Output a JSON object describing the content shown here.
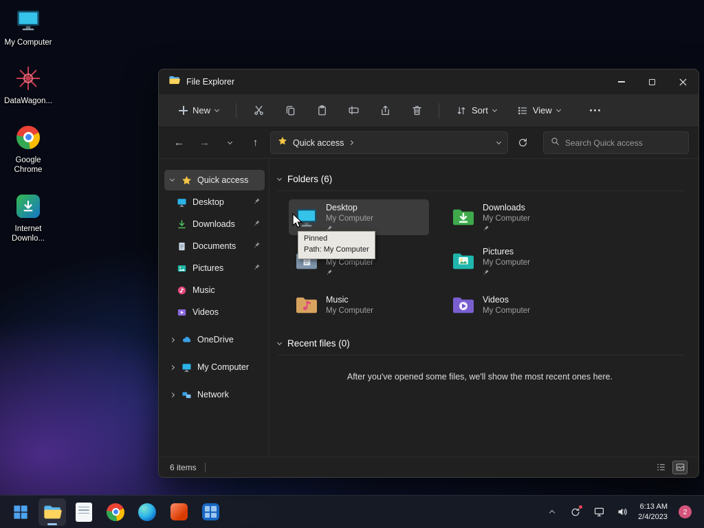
{
  "desktop": {
    "icons": [
      {
        "label": "My Computer"
      },
      {
        "label": "DataWagon..."
      },
      {
        "label": "Google Chrome"
      },
      {
        "label": "Internet Downlo..."
      }
    ]
  },
  "explorer": {
    "title": "File Explorer",
    "toolbar": {
      "new": "New",
      "sort": "Sort",
      "view": "View"
    },
    "address": {
      "crumb": "Quick access"
    },
    "search": {
      "placeholder": "Search Quick access"
    },
    "sidebar": {
      "quick_access": "Quick access",
      "pinned_items": [
        {
          "label": "Desktop",
          "pinned": true
        },
        {
          "label": "Downloads",
          "pinned": true
        },
        {
          "label": "Documents",
          "pinned": true
        },
        {
          "label": "Pictures",
          "pinned": true
        },
        {
          "label": "Music",
          "pinned": false
        },
        {
          "label": "Videos",
          "pinned": false
        }
      ],
      "drives": [
        {
          "label": "OneDrive"
        },
        {
          "label": "My Computer"
        },
        {
          "label": "Network"
        }
      ]
    },
    "content": {
      "folders_header": "Folders (6)",
      "folders": [
        {
          "name": "Desktop",
          "location": "My Computer",
          "pinned": true,
          "selected": true
        },
        {
          "name": "Downloads",
          "location": "My Computer",
          "pinned": true,
          "selected": false
        },
        {
          "name": "Documents",
          "location": "My Computer",
          "pinned": true,
          "selected": false
        },
        {
          "name": "Pictures",
          "location": "My Computer",
          "pinned": true,
          "selected": false
        },
        {
          "name": "Music",
          "location": "My Computer",
          "pinned": false,
          "selected": false
        },
        {
          "name": "Videos",
          "location": "My Computer",
          "pinned": false,
          "selected": false
        }
      ],
      "recent_header": "Recent files (0)",
      "recent_empty": "After you've opened some files, we'll show the most recent ones here."
    },
    "tooltip": {
      "title": "Pinned",
      "path": "Path: My Computer"
    },
    "status": {
      "items": "6 items"
    }
  },
  "taskbar": {
    "clock": {
      "time": "6:13 AM",
      "date": "2/4/2023"
    },
    "badge": "2"
  },
  "colors": {
    "accent": "#4cc2ff",
    "selection": "#3d3d3d",
    "tooltip_bg": "#e9e7e2",
    "badge": "#d4547c",
    "quick_access_star": "#f6c544",
    "downloads_green": "#3fa94c",
    "pictures_teal": "#1fb6ad",
    "music_pink": "#e0497e",
    "videos_purple": "#7a5fd0"
  }
}
